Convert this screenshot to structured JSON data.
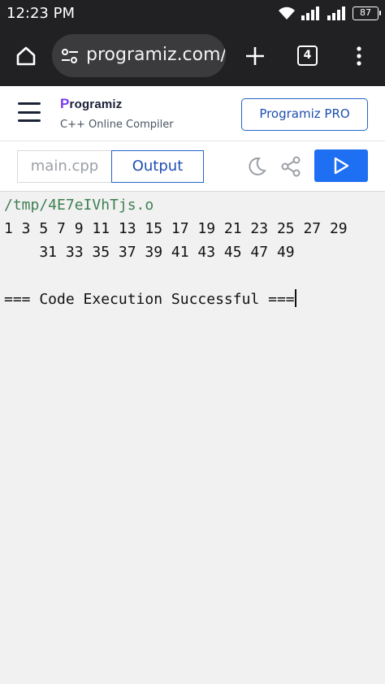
{
  "status_bar": {
    "time": "12:23 PM",
    "battery": "87"
  },
  "browser": {
    "url": "programiz.com/cpp-programming/online-compiler/",
    "tab_count": "4",
    "icons": [
      "home-icon",
      "tune-icon",
      "plus-icon",
      "tabs-icon",
      "more-vert-icon"
    ]
  },
  "site": {
    "brand": "Programiz",
    "subtitle": "C++ Online Compiler",
    "pro_button": "Programiz PRO"
  },
  "editor": {
    "file_tab": "main.cpp",
    "output_tab": "Output",
    "icons": [
      "moon-icon",
      "share-icon",
      "play-icon"
    ],
    "accent_color": "#1f6ff2"
  },
  "output": {
    "path": "/tmp/4E7eIVhTjs.o",
    "line1": "1 3 5 7 9 11 13 15 17 19 21 23 25 27 29",
    "line2": "    31 33 35 37 39 41 43 45 47 49",
    "result": "=== Code Execution Successful ==="
  }
}
